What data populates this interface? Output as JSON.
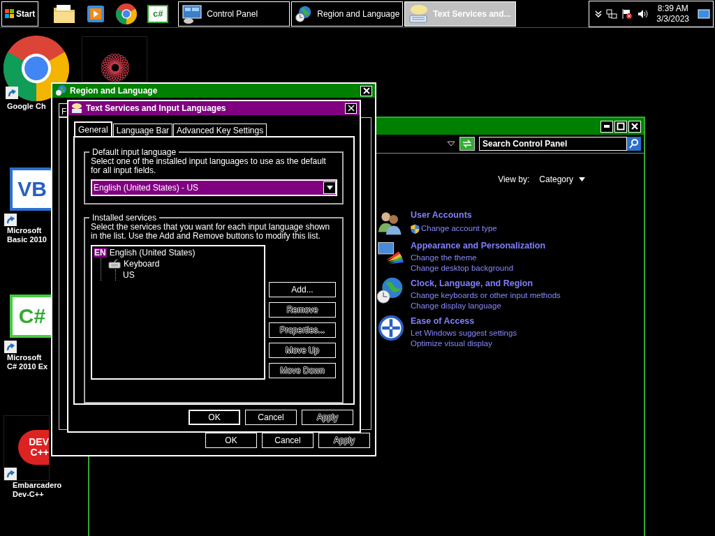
{
  "taskbar": {
    "start": "Start",
    "quick_launch": [
      {
        "kind": "folder"
      },
      {
        "kind": "media"
      },
      {
        "kind": "chrome"
      },
      {
        "kind": "csharp",
        "logo": "c#"
      }
    ],
    "tasks": [
      {
        "label": "Control Panel",
        "kind": "control",
        "selected": false
      },
      {
        "label": "Region and Language",
        "kind": "globe",
        "selected": false
      },
      {
        "label": "Text Services and...",
        "kind": "keyboard",
        "selected": true
      }
    ],
    "clock": {
      "time": "8:39 AM",
      "date": "3/3/2023"
    }
  },
  "desktop_icons": [
    {
      "kind": "chrome",
      "lines": [
        "Google Ch"
      ]
    },
    {
      "kind": "star"
    },
    {
      "kind": "vb",
      "logo": "VB",
      "lines": [
        "Microsoft",
        "Basic 2010"
      ]
    },
    {
      "kind": "csharp",
      "logo": "C#",
      "lines": [
        "Microsoft",
        "C# 2010 Ex"
      ]
    },
    {
      "kind": "devcpp",
      "logo": "DEV",
      "logo2": "C++",
      "lines": [
        "Embarcadero",
        "Dev-C++"
      ]
    }
  ],
  "control_panel": {
    "search": {
      "placeholder": "Search Control Panel"
    },
    "view_by": {
      "label": "View by:",
      "value": "Category"
    },
    "categories": [
      {
        "kind": "users",
        "title": "User Accounts",
        "links": [
          {
            "text": "Change account type",
            "shield": true
          }
        ]
      },
      {
        "kind": "appearance",
        "title": "Appearance and Personalization",
        "links": [
          {
            "text": "Change the theme",
            "shield": false
          },
          {
            "text": "Change desktop background",
            "shield": false
          }
        ]
      },
      {
        "kind": "clock",
        "title": "Clock, Language, and Region",
        "links": [
          {
            "text": "Change keyboards or other input methods",
            "shield": false
          },
          {
            "text": "Change display language",
            "shield": false
          }
        ]
      },
      {
        "kind": "access",
        "title": "Ease of Access",
        "links": [
          {
            "text": "Let Windows suggest settings",
            "shield": false
          },
          {
            "text": "Optimize visual display",
            "shield": false
          }
        ]
      }
    ]
  },
  "region_dialog": {
    "title": "Region and Language",
    "tab_fragment": "F",
    "buttons": [
      {
        "label": "OK",
        "default": false,
        "disabled": false
      },
      {
        "label": "Cancel",
        "default": false,
        "disabled": false
      },
      {
        "label": "Apply",
        "default": false,
        "disabled": true
      }
    ]
  },
  "text_services": {
    "title": "Text Services and Input Languages",
    "tabs": [
      {
        "label": "General",
        "selected": true
      },
      {
        "label": "Language Bar",
        "selected": false
      },
      {
        "label": "Advanced Key Settings",
        "selected": false
      }
    ],
    "default_group": {
      "legend": "Default input language",
      "description": "Select one of the installed input languages to use as the default for all input fields.",
      "dropdown": {
        "value": "English (United States) - US"
      }
    },
    "services_group": {
      "legend": "Installed services",
      "description": "Select the services that you want for each input language shown in the list. Use the Add and Remove buttons to modify this list.",
      "tree": [
        {
          "badge": "EN",
          "label": "English (United States)",
          "children": [
            {
              "label": "Keyboard",
              "children": [
                {
                  "label": "US"
                }
              ]
            }
          ]
        }
      ],
      "buttons": [
        {
          "label": "Add...",
          "disabled": false
        },
        {
          "label": "Remove",
          "disabled": true
        },
        {
          "label": "Properties...",
          "disabled": true
        },
        {
          "label": "Move Up",
          "disabled": true
        },
        {
          "label": "Move Down",
          "disabled": true
        }
      ]
    },
    "buttons": [
      {
        "label": "OK",
        "default": true,
        "disabled": false
      },
      {
        "label": "Cancel",
        "default": false,
        "disabled": false
      },
      {
        "label": "Apply",
        "default": false,
        "disabled": true
      }
    ]
  }
}
